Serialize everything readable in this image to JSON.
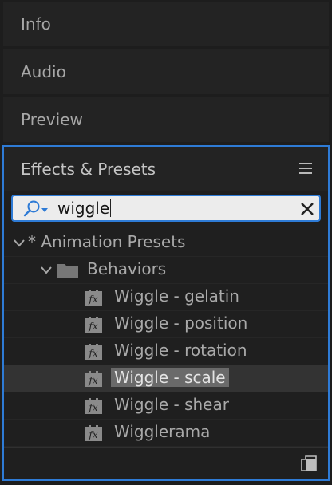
{
  "collapsed_panels": [
    {
      "label": "Info"
    },
    {
      "label": "Audio"
    },
    {
      "label": "Preview"
    }
  ],
  "effects_panel": {
    "title": "Effects & Presets",
    "menu_icon": "hamburger-menu-icon",
    "search": {
      "value": "wiggle",
      "icon": "magnifier-dropdown-icon",
      "clear_icon": "close-icon"
    },
    "tree": [
      {
        "label": "* Animation Presets",
        "level": 0,
        "type": "group",
        "expanded": true
      },
      {
        "label": "Behaviors",
        "level": 1,
        "type": "folder",
        "expanded": true
      },
      {
        "label": "Wiggle - gelatin",
        "level": 2,
        "type": "preset",
        "icon": "fx-preset-icon"
      },
      {
        "label": "Wiggle - position",
        "level": 2,
        "type": "preset",
        "icon": "fx-preset-icon"
      },
      {
        "label": "Wiggle - rotation",
        "level": 2,
        "type": "preset",
        "icon": "fx-preset-icon"
      },
      {
        "label": "Wiggle - scale",
        "level": 2,
        "type": "preset",
        "icon": "fx-preset-icon",
        "selected": true
      },
      {
        "label": "Wiggle - shear",
        "level": 2,
        "type": "preset",
        "icon": "fx-preset-icon"
      },
      {
        "label": "Wigglerama",
        "level": 2,
        "type": "preset",
        "icon": "fx-preset-icon"
      }
    ],
    "footer_icon": "new-bin-icon"
  },
  "colors": {
    "accent": "#2e7bd6",
    "background": "#1d1d1d",
    "panel": "#232323",
    "selection": "#333333"
  }
}
